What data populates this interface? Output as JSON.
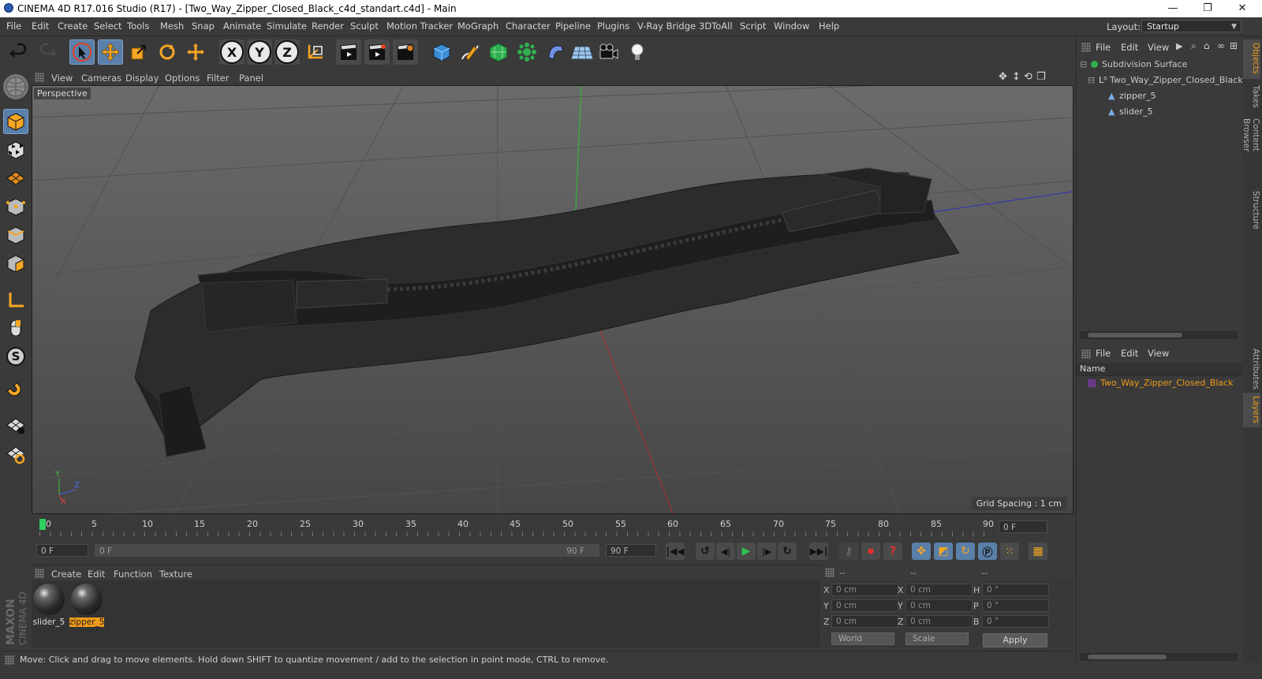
{
  "titlebar": {
    "title": "CINEMA 4D R17.016 Studio (R17) - [Two_Way_Zipper_Closed_Black_c4d_standart.c4d] - Main",
    "minimize": "—",
    "maximize": "❐",
    "close": "✕"
  },
  "menubar": {
    "items": [
      "File",
      "Edit",
      "Create",
      "Select",
      "Tools",
      "Mesh",
      "Snap",
      "Animate",
      "Simulate",
      "Render",
      "Sculpt",
      "Motion Tracker",
      "MoGraph",
      "Character",
      "Pipeline",
      "Plugins",
      "V-Ray Bridge",
      "3DToAll",
      "Script",
      "Window",
      "Help"
    ],
    "layout_label": "Layout:",
    "layout_value": "Startup"
  },
  "viewport": {
    "menu": [
      "View",
      "Cameras",
      "Display",
      "Options",
      "Filter",
      "Panel"
    ],
    "camera_label": "Perspective",
    "grid_spacing": "Grid Spacing : 1 cm",
    "axis_y": "Y",
    "axis_z": "Z",
    "axis_x": "X"
  },
  "timeline": {
    "ticks": [
      "0",
      "5",
      "10",
      "15",
      "20",
      "25",
      "30",
      "35",
      "40",
      "45",
      "50",
      "55",
      "60",
      "65",
      "70",
      "75",
      "80",
      "85",
      "90"
    ],
    "current_frame": "0 F",
    "start_field": "0 F",
    "range_start": "0 F",
    "range_end": "90 F",
    "end_field": "90 F"
  },
  "materials": {
    "menu": [
      "Create",
      "Edit",
      "Function",
      "Texture"
    ],
    "items": [
      {
        "name": "slider_5",
        "selected": false
      },
      {
        "name": "zipper_5",
        "selected": true
      }
    ]
  },
  "coordinates": {
    "header": [
      "--",
      "--",
      "--"
    ],
    "pos": [
      {
        "axis": "X",
        "value": "0 cm"
      },
      {
        "axis": "Y",
        "value": "0 cm"
      },
      {
        "axis": "Z",
        "value": "0 cm"
      }
    ],
    "size": [
      {
        "axis": "X",
        "value": "0 cm"
      },
      {
        "axis": "Y",
        "value": "0 cm"
      },
      {
        "axis": "Z",
        "value": "0 cm"
      }
    ],
    "rot": [
      {
        "axis": "H",
        "value": "0 °"
      },
      {
        "axis": "P",
        "value": "0 °"
      },
      {
        "axis": "B",
        "value": "0 °"
      }
    ],
    "mode": "World",
    "scale": "Scale",
    "apply": "Apply"
  },
  "status": {
    "text": "Move: Click and drag to move elements. Hold down SHIFT to quantize movement / add to the selection in point mode, CTRL to remove."
  },
  "object_manager": {
    "menu": [
      "File",
      "Edit",
      "View"
    ],
    "objects": [
      {
        "name": "Subdivision Surface",
        "indent": 0
      },
      {
        "name": "Two_Way_Zipper_Closed_Black",
        "indent": 1
      },
      {
        "name": "zipper_5",
        "indent": 2
      },
      {
        "name": "slider_5",
        "indent": 2
      }
    ]
  },
  "layer_manager": {
    "menu": [
      "File",
      "Edit",
      "View"
    ],
    "column": "Name",
    "layers": [
      "Two_Way_Zipper_Closed_Black"
    ]
  },
  "right_tabs": [
    "Objects",
    "Takes",
    "Content Browser",
    "Structure",
    "Attributes",
    "Layers"
  ],
  "logo": {
    "line1": "MAXON",
    "line2": "CINEMA 4D"
  },
  "colors": {
    "accent": "#f09a1b",
    "selection": "#5a7fa8",
    "bg": "#3a3a3a"
  }
}
